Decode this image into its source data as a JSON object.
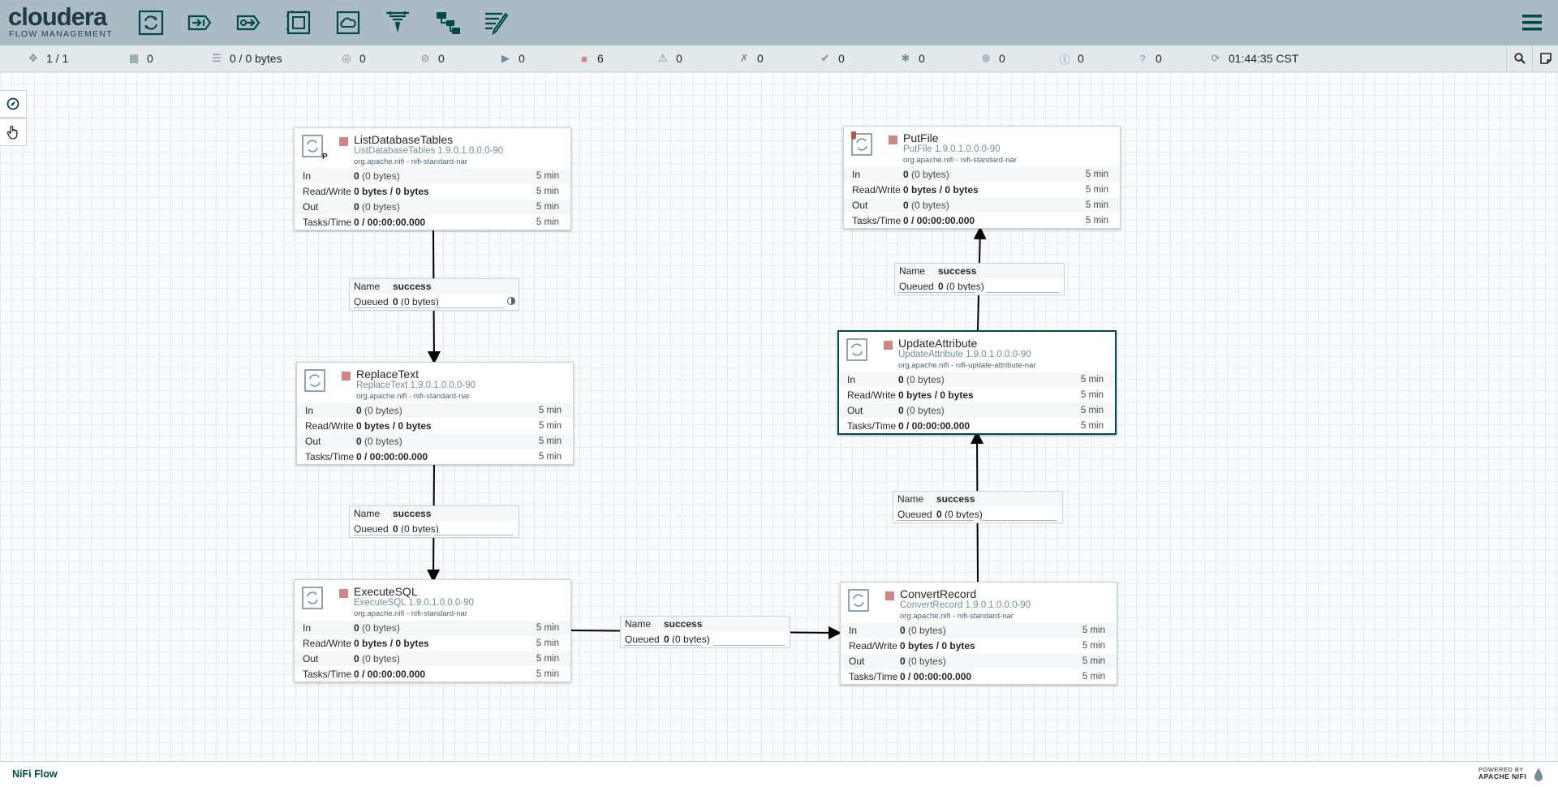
{
  "header": {
    "brand": "cloudera",
    "subtitle": "FLOW MANAGEMENT",
    "tools": [
      "processor-icon",
      "input-port-icon",
      "output-port-icon",
      "process-group-icon",
      "remote-process-group-icon",
      "funnel-icon",
      "template-icon",
      "label-icon"
    ]
  },
  "status": {
    "clusters": "1 / 1",
    "transmitting": "0",
    "queued": "0 / 0 bytes",
    "not_transmitting": "0",
    "disabled_transmitting": "0",
    "running": "0",
    "stopped": "6",
    "invalid": "0",
    "disabled": "0",
    "up_to_date": "0",
    "locally_modified": "0",
    "stale": "0",
    "errors": "0",
    "sync_failure": "0",
    "refresh_time": "01:44:35 CST"
  },
  "labels": {
    "in": "In",
    "rw": "Read/Write",
    "out": "Out",
    "tasks": "Tasks/Time",
    "five_min": "5 min",
    "zero": "0",
    "zero_bytes": "(0 bytes)",
    "bytes_rw": "0 bytes / 0 bytes",
    "tasks_val": "0 / 00:00:00.000",
    "name": "Name",
    "queued": "Queued",
    "success": "success"
  },
  "processors": [
    {
      "name": "ListDatabaseTables",
      "type": "ListDatabaseTables 1.9.0.1.0.0.0-90",
      "bundle": "org.apache.nifi - nifi-standard-nar",
      "tag": "P"
    },
    {
      "name": "ReplaceText",
      "type": "ReplaceText 1.9.0.1.0.0.0-90",
      "bundle": "org.apache.nifi - nifi-standard-nar"
    },
    {
      "name": "ExecuteSQL",
      "type": "ExecuteSQL 1.9.0.1.0.0.0-90",
      "bundle": "org.apache.nifi - nifi-standard-nar"
    },
    {
      "name": "PutFile",
      "type": "PutFile 1.9.0.1.0.0.0-90",
      "bundle": "org.apache.nifi - nifi-standard-nar"
    },
    {
      "name": "UpdateAttribute",
      "type": "UpdateAttribute 1.9.0.1.0.0.0-90",
      "bundle": "org.apache.nifi - nifi-update-attribute-nar"
    },
    {
      "name": "ConvertRecord",
      "type": "ConvertRecord 1.9.0.1.0.0.0-90",
      "bundle": "org.apache.nifi - nifi-standard-nar"
    }
  ],
  "footer": {
    "breadcrumb": "NiFi Flow",
    "powered_by": "POWERED BY",
    "apache_nifi": "APACHE NIFI"
  },
  "colors": {
    "header_bg": "#aabbc3",
    "stopped": "#d18686",
    "accent": "#004849"
  }
}
